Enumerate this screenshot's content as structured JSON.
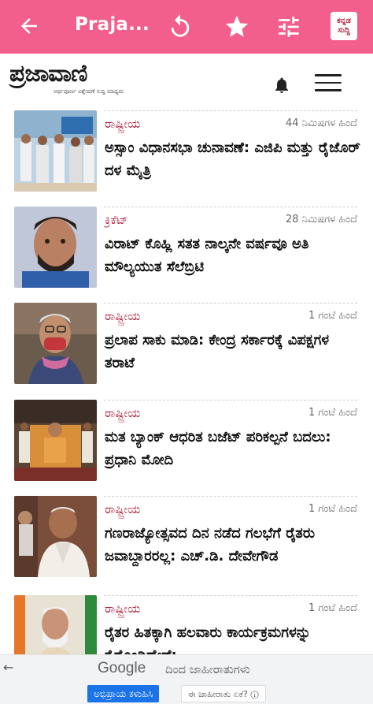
{
  "app_bar": {
    "title": "Praja...",
    "lang_badge_line1": "ಕನ್ನಡ",
    "lang_badge_line2": "ಸುದ್ದಿ",
    "color": "#f35f8d"
  },
  "masthead": {
    "logo_text": "ಪ್ರಜಾವಾಣಿ",
    "logo_tagline": "ಅರ್ಥಪೂರ್ಣ ವಿಶ್ಲೇಷಣೆ ಸುದ್ದಿ ಮಾಧ್ಯಮ"
  },
  "news": [
    {
      "category": "ರಾಷ್ಟ್ರೀಯ",
      "time": "44 ನಿಮಿಷಗಳ ಹಿಂದೆ",
      "headline": "ಅಸ್ಸಾಂ ವಿಧಾನಸಭಾ ಚುನಾವಣೆ: ಎಜಿಪಿ ಮತ್ತು ರೈಜೊರ್ ದಳ ಮೈತ್ರಿ"
    },
    {
      "category": "ಕ್ರಿಕೆಟ್",
      "time": "28 ನಿಮಿಷಗಳ ಹಿಂದೆ",
      "headline": "ವಿರಾಟ್ ಕೊಹ್ಲಿ ಸತತ ನಾಲ್ಕನೇ ವರ್ಷವೂ ಅತಿ ಮೌಲ್ಯಯುತ ಸೆಲೆಬ್ರಿಟಿ"
    },
    {
      "category": "ರಾಷ್ಟ್ರೀಯ",
      "time": "1 ಗಂಟೆ ಹಿಂದೆ",
      "headline": "ಪ್ರಲಾಪ ಸಾಕು ಮಾಡಿ: ಕೇಂದ್ರ ಸರ್ಕಾರಕ್ಕೆ ವಿಪಕ್ಷಗಳ ತರಾಟೆ"
    },
    {
      "category": "ರಾಷ್ಟ್ರೀಯ",
      "time": "1 ಗಂಟೆ ಹಿಂದೆ",
      "headline": "ಮತ ಬ್ಯಾಂಕ್ ಆಧರಿತ ಬಜೆಟ್ ಪರಿಕಲ್ಪನೆ ಬದಲು: ಪ್ರಧಾನಿ ಮೋದಿ"
    },
    {
      "category": "ರಾಷ್ಟ್ರೀಯ",
      "time": "1 ಗಂಟೆ ಹಿಂದೆ",
      "headline": "ಗಣರಾಜ್ಯೋತ್ಸವದ ದಿನ ನಡೆದ ಗಲಭೆಗೆ ರೈತರು ಜವಾಬ್ದಾರರಲ್ಲ: ಎಚ್.ಡಿ. ದೇವೇಗೌಡ"
    },
    {
      "category": "ರಾಷ್ಟ್ರೀಯ",
      "time": "1 ಗಂಟೆ ಹಿಂದೆ",
      "headline": "ರೈತರ ಹಿತಕ್ಕಾಗಿ ಹಲವಾರು ಕಾರ್ಯಕ್ರಮಗಳನ್ನು ಕೈಗೊಂಡಿದ್ದೇವೆ:"
    }
  ],
  "ad": {
    "google": "Google",
    "provided_by": "ದಿಂದ ಜಾಹೀರಾತುಗಳು",
    "feedback_button": "ಅಭಿಪ್ರಾಯ ಕಳುಹಿಸಿ",
    "why_ad": "ಈ ಜಾಹೀರಾತು ಏಕೆ? ⓘ"
  }
}
